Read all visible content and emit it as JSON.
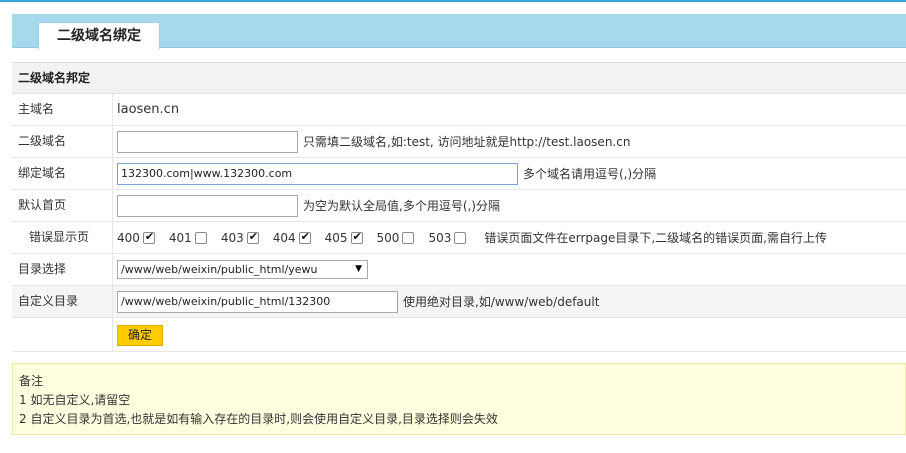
{
  "tab": {
    "label": "二级域名绑定"
  },
  "form": {
    "section_title": "二级域名邦定",
    "main_domain": {
      "label": "主域名",
      "value": "laosen.cn"
    },
    "subdomain": {
      "label": "二级域名",
      "value": "",
      "hint": "只需填二级域名,如:test, 访问地址就是http://test.laosen.cn"
    },
    "bind_domain": {
      "label": "绑定域名",
      "value": "132300.com|www.132300.com",
      "hint": "多个域名请用逗号(,)分隔"
    },
    "default_page": {
      "label": "默认首页",
      "value": "",
      "hint": "为空为默认全局值,多个用逗号(,)分隔"
    },
    "error_pages": {
      "label": "错误显示页",
      "items": [
        {
          "code": "400",
          "checked": true
        },
        {
          "code": "401",
          "checked": false
        },
        {
          "code": "403",
          "checked": true
        },
        {
          "code": "404",
          "checked": true
        },
        {
          "code": "405",
          "checked": true
        },
        {
          "code": "500",
          "checked": false
        },
        {
          "code": "503",
          "checked": false
        }
      ],
      "hint": "错误页面文件在errpage目录下,二级域名的错误页面,需自行上传"
    },
    "dir_select": {
      "label": "目录选择",
      "selected": "/www/web/weixin/public_html/yewu"
    },
    "custom_dir": {
      "label": "自定义目录",
      "value": "/www/web/weixin/public_html/132300",
      "hint": "使用绝对目录,如/www/web/default"
    },
    "submit_label": "确定"
  },
  "notes": {
    "title": "备注",
    "lines": [
      "1 如无自定义,请留空",
      "2 自定义目录为首选,也就是如有输入存在的目录时,则会使用自定义目录,目录选择则会失效"
    ]
  },
  "colors": {
    "tabbar": "#a6d8ee",
    "button": "#ffcc00",
    "note_bg": "#ffffe0"
  }
}
